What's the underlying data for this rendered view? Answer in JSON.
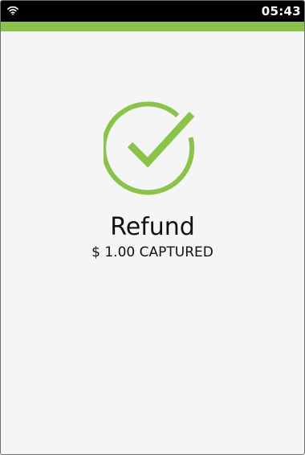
{
  "status_bar": {
    "time": "05:43",
    "wifi_icon": "wifi-icon"
  },
  "colors": {
    "accent": "#8bc34a",
    "status_bar_bg": "#000000",
    "background": "#f5f5f5",
    "text": "#111111"
  },
  "result": {
    "icon": "check-circle-icon",
    "title": "Refund",
    "amount_status": "$ 1.00 CAPTURED"
  }
}
